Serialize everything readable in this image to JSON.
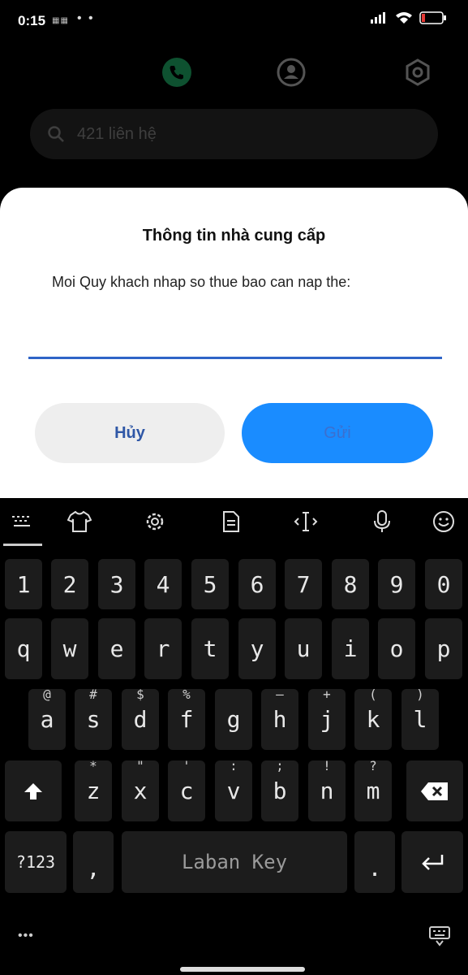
{
  "status_bar": {
    "time": "0:15",
    "small_icons": "▦▦",
    "dots": "• •"
  },
  "dialer": {
    "tabs": [
      {
        "icon": "phone-icon",
        "active": true
      },
      {
        "icon": "contacts-icon",
        "active": false
      },
      {
        "icon": "settings-icon",
        "active": false
      }
    ],
    "search_placeholder": "421 liên hệ"
  },
  "dialog": {
    "title": "Thông tin nhà cung cấp",
    "message": "Moi Quy khach nhap so thue bao can nap the:",
    "input_value": "",
    "cancel_label": "Hủy",
    "send_label": "Gửi",
    "accent": "#2f64c7",
    "send_color": "#1a8cff"
  },
  "keyboard": {
    "toolbar_icons": [
      "keyboard-icon",
      "tshirt-icon",
      "gear-icon",
      "clipboard-icon",
      "cursor-icon",
      "mic-icon",
      "emoji-icon"
    ],
    "row_numbers": [
      "1",
      "2",
      "3",
      "4",
      "5",
      "6",
      "7",
      "8",
      "9",
      "0"
    ],
    "row_top": [
      "q",
      "w",
      "e",
      "r",
      "t",
      "y",
      "u",
      "i",
      "o",
      "p"
    ],
    "row_middle": [
      {
        "key": "a",
        "hint": "@"
      },
      {
        "key": "s",
        "hint": "#"
      },
      {
        "key": "d",
        "hint": "$"
      },
      {
        "key": "f",
        "hint": "%"
      },
      {
        "key": "g",
        "hint": ""
      },
      {
        "key": "h",
        "hint": "–"
      },
      {
        "key": "j",
        "hint": "+"
      },
      {
        "key": "k",
        "hint": "("
      },
      {
        "key": "l",
        "hint": ")"
      }
    ],
    "row_bottom": [
      {
        "key": "z",
        "hint": "*"
      },
      {
        "key": "x",
        "hint": "\""
      },
      {
        "key": "c",
        "hint": "'"
      },
      {
        "key": "v",
        "hint": ":"
      },
      {
        "key": "b",
        "hint": ";"
      },
      {
        "key": "n",
        "hint": "!"
      },
      {
        "key": "m",
        "hint": "?"
      }
    ],
    "symbols_label": "?123",
    "comma_label": ",",
    "space_label": "Laban Key",
    "period_label": ".",
    "more_label": "•••"
  }
}
